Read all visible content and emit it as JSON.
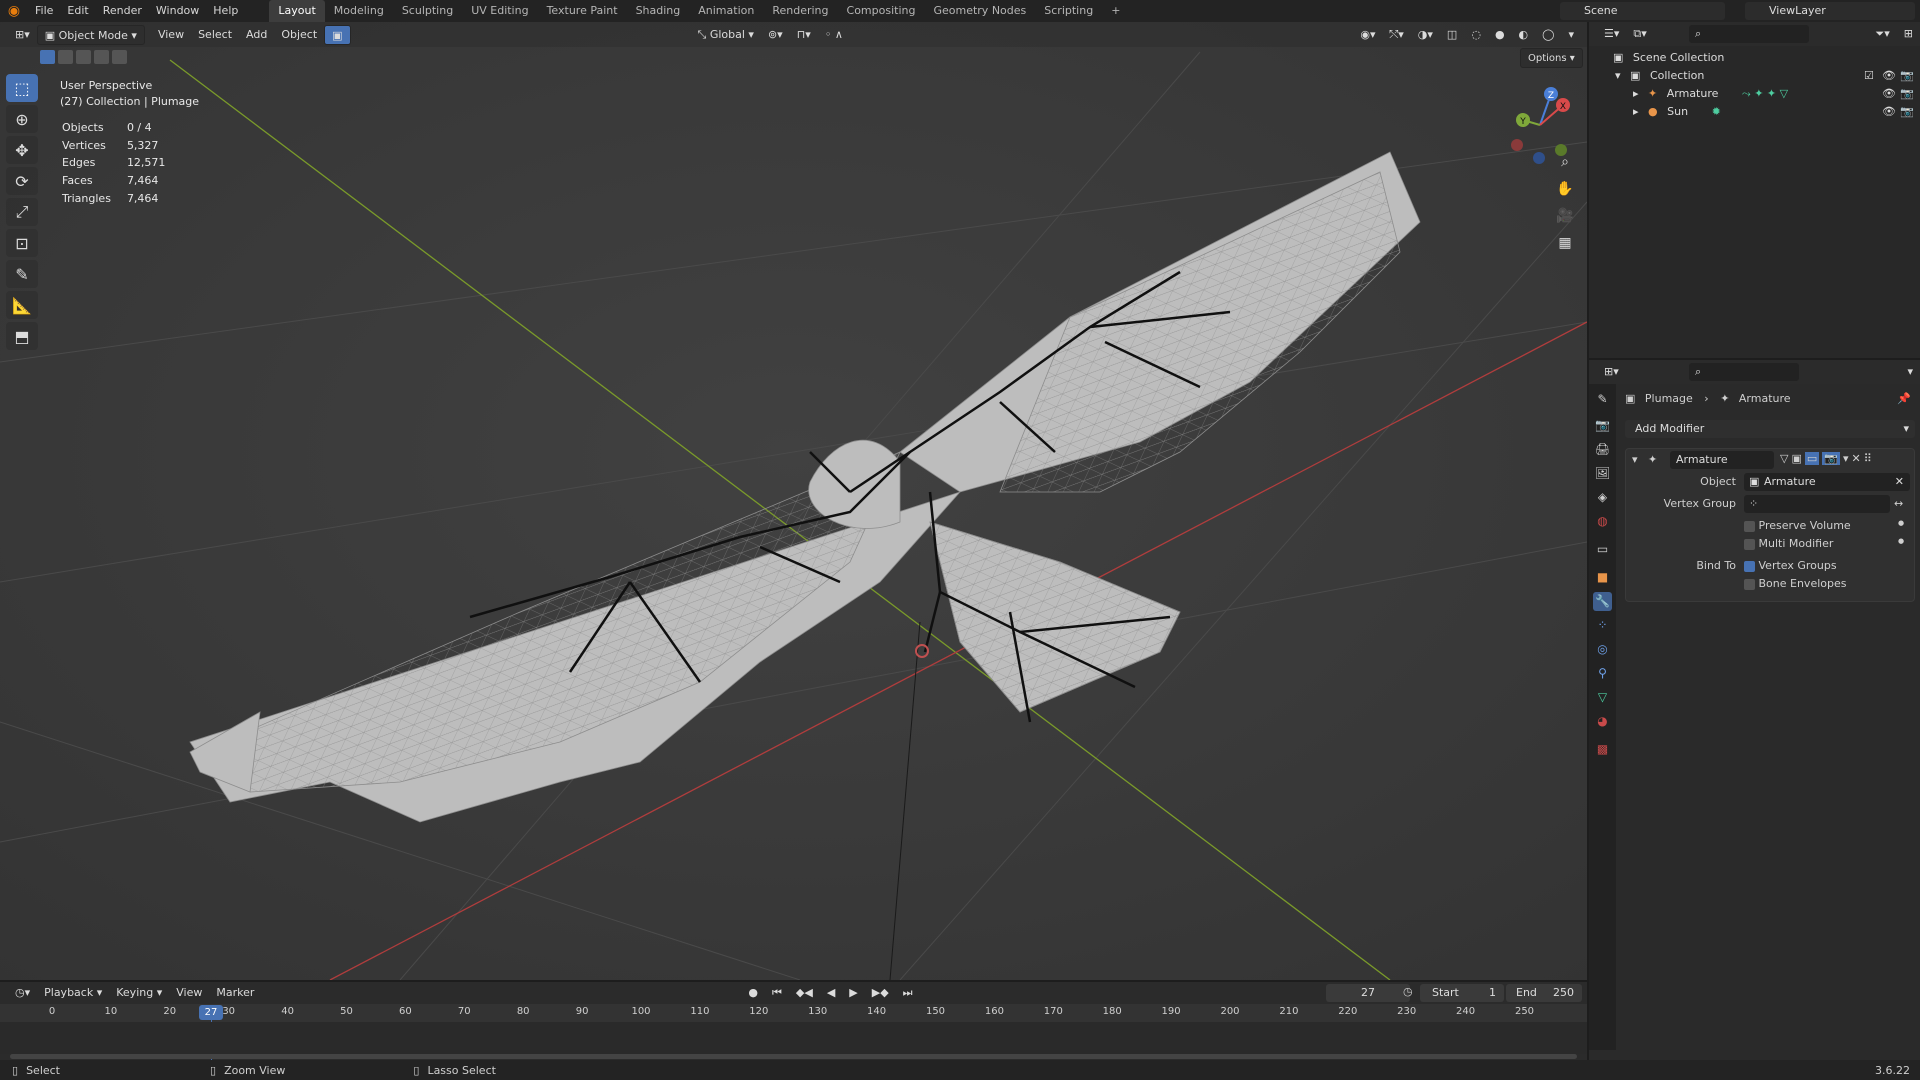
{
  "topbar": {
    "menu": [
      "File",
      "Edit",
      "Render",
      "Window",
      "Help"
    ],
    "workspaces": [
      "Layout",
      "Modeling",
      "Sculpting",
      "UV Editing",
      "Texture Paint",
      "Shading",
      "Animation",
      "Rendering",
      "Compositing",
      "Geometry Nodes",
      "Scripting"
    ],
    "add_tab": "+",
    "scene": "Scene",
    "view_layer": "ViewLayer"
  },
  "viewport_header": {
    "mode": "Object Mode",
    "menus": [
      "View",
      "Select",
      "Add",
      "Object"
    ],
    "transform_orientation": "Global",
    "options": "Options"
  },
  "overlay": {
    "view_name": "User Perspective",
    "collection": "(27) Collection | Plumage",
    "stats": [
      {
        "label": "Objects",
        "value": "0 / 4"
      },
      {
        "label": "Vertices",
        "value": "5,327"
      },
      {
        "label": "Edges",
        "value": "12,571"
      },
      {
        "label": "Faces",
        "value": "7,464"
      },
      {
        "label": "Triangles",
        "value": "7,464"
      }
    ]
  },
  "gizmo": {
    "x": "X",
    "y": "Y",
    "z": "Z"
  },
  "outliner": {
    "scene_collection": "Scene Collection",
    "collection": "Collection",
    "items": [
      {
        "name": "Armature"
      },
      {
        "name": "Sun"
      }
    ]
  },
  "properties": {
    "breadcrumb_object": "Plumage",
    "breadcrumb_data": "Armature",
    "add_modifier": "Add Modifier",
    "modifier_name": "Armature",
    "object_label": "Object",
    "object_value": "Armature",
    "vertex_group_label": "Vertex Group",
    "preserve_volume": "Preserve Volume",
    "multi_modifier": "Multi Modifier",
    "bind_to_label": "Bind To",
    "vertex_groups": "Vertex Groups",
    "bone_envelopes": "Bone Envelopes"
  },
  "timeline": {
    "menus": [
      "Playback",
      "Keying",
      "View",
      "Marker"
    ],
    "current_frame": "27",
    "start_label": "Start",
    "start_value": "1",
    "end_label": "End",
    "end_value": "250",
    "ticks": [
      "0",
      "10",
      "20",
      "30",
      "40",
      "50",
      "60",
      "70",
      "80",
      "90",
      "100",
      "110",
      "120",
      "130",
      "140",
      "150",
      "160",
      "170",
      "180",
      "190",
      "200",
      "210",
      "220",
      "230",
      "240",
      "250"
    ]
  },
  "statusbar": {
    "select": "Select",
    "zoom_view": "Zoom View",
    "lasso_select": "Lasso Select",
    "version": "3.6.22"
  }
}
